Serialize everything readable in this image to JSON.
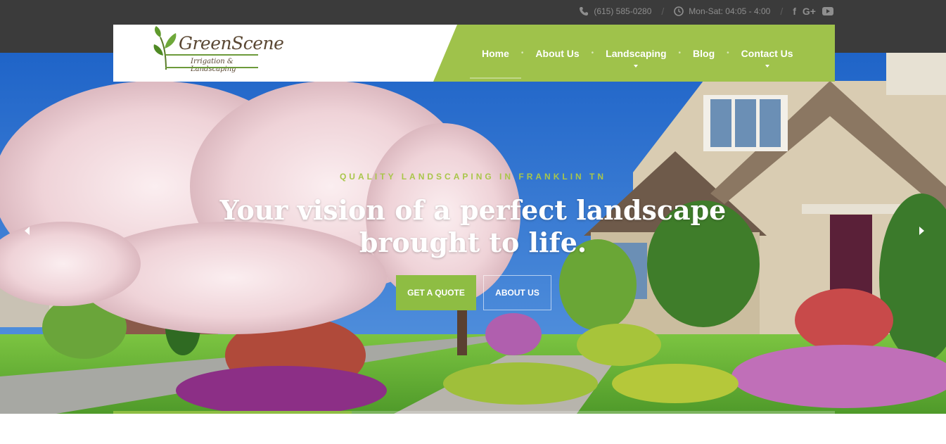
{
  "topbar": {
    "phone": "(615) 585-0280",
    "hours": "Mon-Sat: 04:05 - 4:00",
    "social_facebook": "f",
    "social_google": "G+"
  },
  "logo": {
    "name": "GreenScene",
    "subtitle": "Irrigation & Landscaping"
  },
  "nav": {
    "items": [
      {
        "label": "Home"
      },
      {
        "label": "About Us"
      },
      {
        "label": "Landscaping"
      },
      {
        "label": "Blog"
      },
      {
        "label": "Contact Us"
      }
    ]
  },
  "hero": {
    "tagline": "QUALITY LANDSCAPING IN FRANKLIN TN",
    "headline_line1": "Your vision of a perfect landscape",
    "headline_line2": "brought to life.",
    "cta_primary": "GET A QUOTE",
    "cta_secondary": "ABOUT US",
    "slide_progress": 0.33
  },
  "colors": {
    "accent": "#8ebd43",
    "nav_green": "#9fc24b",
    "topbar": "#3b3b3b",
    "tagline": "#a9c64a"
  },
  "icons": [
    "phone-icon",
    "clock-icon",
    "facebook-icon",
    "google-plus-icon",
    "youtube-icon",
    "leaf-icon",
    "arrow-left-icon",
    "arrow-right-icon"
  ]
}
